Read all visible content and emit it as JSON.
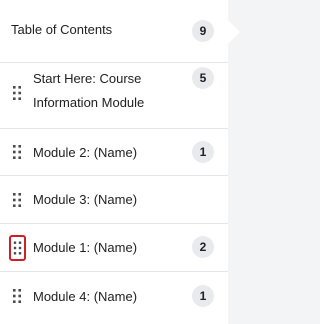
{
  "toc": {
    "title": "Table of Contents",
    "count": "9"
  },
  "modules": [
    {
      "line1": "Start Here: Course",
      "line2": "Information Module",
      "count": "5",
      "focused": false
    },
    {
      "line1": "Module 2: (Name)",
      "line2": "",
      "count": "1",
      "focused": false
    },
    {
      "line1": "Module 3: (Name)",
      "line2": "",
      "count": "",
      "focused": false
    },
    {
      "line1": "Module 1: (Name)",
      "line2": "",
      "count": "2",
      "focused": true
    },
    {
      "line1": "Module 4: (Name)",
      "line2": "",
      "count": "1",
      "focused": false
    }
  ],
  "colors": {
    "focus_ring": "#cd2026",
    "badge_bg": "#e8eaee"
  },
  "icons": {
    "drag": "drag-handle-icon"
  }
}
